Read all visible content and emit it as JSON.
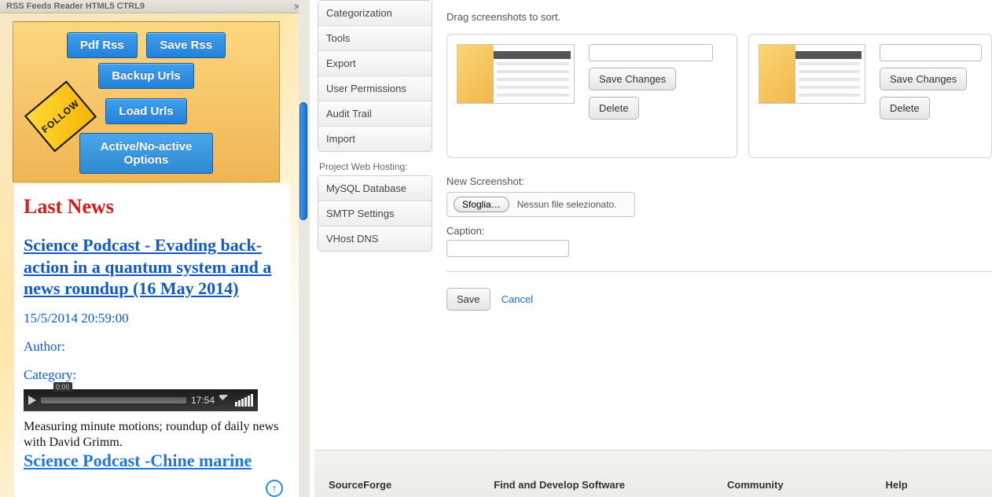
{
  "panel": {
    "title": "RSS Feeds Reader HTML5    CTRL9",
    "close_glyph": "×",
    "buttons": {
      "pdf": "Pdf Rss",
      "save": "Save Rss",
      "backup": "Backup Urls",
      "load": "Load Urls",
      "active": "Active/No-active Options"
    },
    "follow": "FOLLOW"
  },
  "news": {
    "heading": "Last News",
    "article_title": "Science Podcast - Evading back-action in a quantum system and a news roundup (16 May 2014)",
    "date": "15/5/2014 20:59:00",
    "author_label": "Author:",
    "category_label": "Category:",
    "player": {
      "pos": "0:00",
      "dur": "17:54"
    },
    "summary": "Measuring minute motions; roundup of daily news with David Grimm.",
    "next_title": "Science Podcast -Chine marine"
  },
  "nav": {
    "items1": [
      "Categorization",
      "Tools",
      "Export",
      "User Permissions",
      "Audit Trail",
      "Import"
    ],
    "hosting_label": "Project Web Hosting:",
    "items2": [
      "MySQL Database",
      "SMTP Settings",
      "VHost DNS"
    ]
  },
  "main": {
    "instruction": "Drag screenshots to sort.",
    "save_changes": "Save Changes",
    "delete": "Delete",
    "new_label": "New Screenshot:",
    "browse": "Sfoglia…",
    "no_file": "Nessun file selezionato.",
    "caption_label": "Caption:",
    "save": "Save",
    "cancel": "Cancel"
  },
  "footer": {
    "c1": "SourceForge",
    "c2": "Find and Develop Software",
    "c3": "Community",
    "c4": "Help"
  }
}
